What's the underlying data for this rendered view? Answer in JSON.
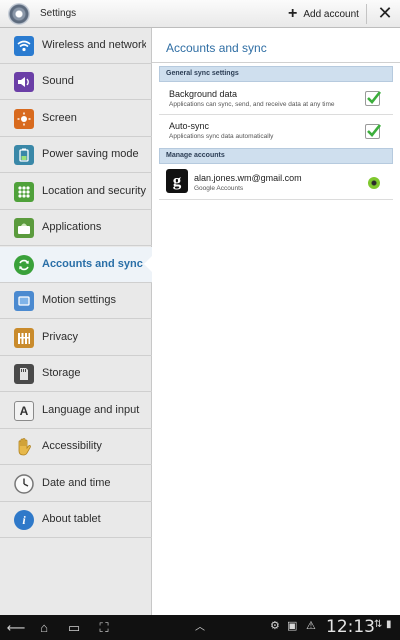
{
  "header": {
    "app_title": "Settings",
    "add_account_label": "Add account"
  },
  "sidebar": {
    "items": [
      {
        "label": "Wireless and networks",
        "icon": "wifi-icon",
        "color": "#2a7bd0"
      },
      {
        "label": "Sound",
        "icon": "sound-icon",
        "color": "#6b3fa7"
      },
      {
        "label": "Screen",
        "icon": "screen-icon",
        "color": "#d86a1e"
      },
      {
        "label": "Power saving mode",
        "icon": "power-saving-icon",
        "color": "#3a88a8"
      },
      {
        "label": "Location and security",
        "icon": "location-icon",
        "color": "#4fa13a"
      },
      {
        "label": "Applications",
        "icon": "applications-icon",
        "color": "#5b9b3d"
      },
      {
        "label": "Accounts and sync",
        "icon": "sync-icon",
        "color": "#3aa13a"
      },
      {
        "label": "Motion settings",
        "icon": "motion-icon",
        "color": "#4b8ad0"
      },
      {
        "label": "Privacy",
        "icon": "privacy-icon",
        "color": "#c98b2c"
      },
      {
        "label": "Storage",
        "icon": "storage-icon",
        "color": "#4a4a4a"
      },
      {
        "label": "Language and input",
        "icon": "language-icon",
        "color": "#6d6d6d"
      },
      {
        "label": "Accessibility",
        "icon": "accessibility-icon",
        "color": "#d7a63a"
      },
      {
        "label": "Date and time",
        "icon": "clock-icon",
        "color": "#8a8a8a"
      },
      {
        "label": "About tablet",
        "icon": "info-icon",
        "color": "#2f79c9"
      }
    ],
    "active_index": 6
  },
  "main": {
    "title": "Accounts and sync",
    "general_header": "General sync settings",
    "background_data": {
      "title": "Background data",
      "subtitle": "Applications can sync, send, and receive data at any time",
      "checked": true
    },
    "auto_sync": {
      "title": "Auto-sync",
      "subtitle": "Applications sync data automatically",
      "checked": true
    },
    "manage_header": "Manage accounts",
    "account": {
      "email": "alan.jones.wm@gmail.com",
      "type": "Google Accounts",
      "icon_letter": "g"
    }
  },
  "system_bar": {
    "time": "12:13"
  },
  "colors": {
    "accent": "#2f6ea4",
    "check_green": "#3cae3c",
    "section_bg": "#cfdfee"
  }
}
